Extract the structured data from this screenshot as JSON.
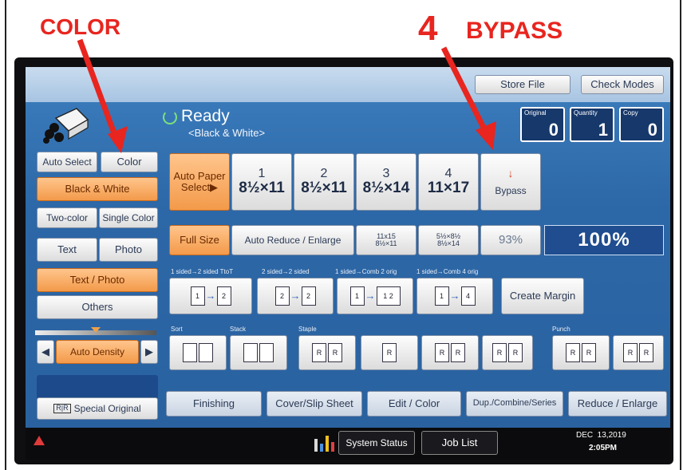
{
  "annotations": {
    "color_label": "COLOR",
    "number_label": "4",
    "bypass_label": "BYPASS",
    "color": "#e8251f"
  },
  "header": {
    "store_file": "Store File",
    "check_modes": "Check Modes",
    "status": "Ready",
    "mode": "<Black & White>",
    "counters": [
      {
        "label": "Original",
        "value": "0"
      },
      {
        "label": "Quantity",
        "value": "1"
      },
      {
        "label": "Copy",
        "value": "0"
      }
    ]
  },
  "color_panel": {
    "auto_select": "Auto Select",
    "color": "Color",
    "black_white": "Black & White",
    "two_color": "Two-color",
    "single_color": "Single Color",
    "text": "Text",
    "photo": "Photo",
    "text_photo": "Text / Photo",
    "others": "Others",
    "density_left": "◀",
    "auto_density": "Auto Density",
    "density_right": "▶",
    "special_original": "Special Original"
  },
  "paper": {
    "auto_paper": "Auto Paper",
    "select": "Select▶",
    "trays": [
      {
        "num": "1",
        "size": "8½×11"
      },
      {
        "num": "2",
        "size": "8½×11"
      },
      {
        "num": "3",
        "size": "8½×14"
      },
      {
        "num": "4",
        "size": "11×17"
      }
    ],
    "bypass": "Bypass",
    "bypass_icon": "↓"
  },
  "reduce": {
    "full_size": "Full Size",
    "auto_reduce": "Auto Reduce / Enlarge",
    "preset1_line1": "11x15",
    "preset1_line2": "8½×11",
    "preset2_line1": "5½×8½",
    "preset2_line2": "8½×14",
    "ratio": "93%",
    "display": "100%"
  },
  "duplex": {
    "labels": [
      "1 sided→2 sided TtoT",
      "2 sided→2 sided",
      "1 sided→Comb 2 orig",
      "1 sided→Comb 4 orig"
    ],
    "create_margin": "Create Margin"
  },
  "finish_labels": {
    "sort": "Sort",
    "stack": "Stack",
    "staple": "Staple",
    "punch": "Punch"
  },
  "tabs": [
    "Finishing",
    "Cover/Slip Sheet",
    "Edit / Color",
    "Dup./Combine/Series",
    "Reduce / Enlarge"
  ],
  "footer": {
    "system_status": "System Status",
    "job_list": "Job List",
    "date": "DEC  13,2019",
    "time": "2:05PM"
  }
}
